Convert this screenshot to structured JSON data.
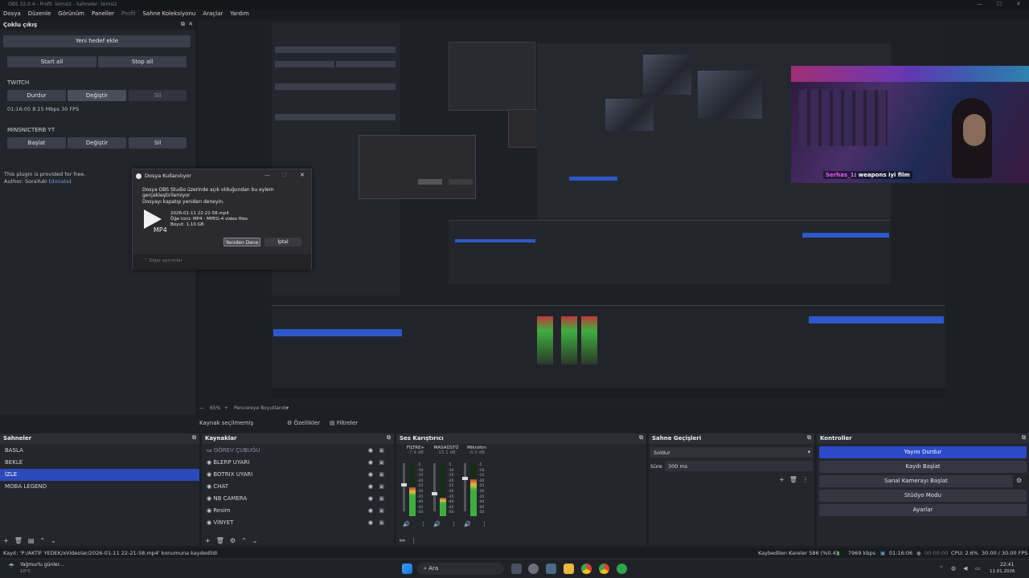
{
  "window": {
    "title": "OBS 32.0.4 - Profil: İsimsiz - Sahneler: İsimsiz"
  },
  "menu": [
    "Dosya",
    "Düzenle",
    "Görünüm",
    "Paneller",
    "Profil",
    "Sahne Koleksiyonu",
    "Araçlar",
    "Yardım"
  ],
  "multi_output": {
    "title": "Çoklu çıkış",
    "new_target": "Yeni hedef ekle",
    "start_all": "Start all",
    "stop_all": "Stop all",
    "targets": [
      {
        "name": "TWITCH",
        "primary": "Durdur",
        "edit": "Değiştir",
        "delete": "Sil",
        "stats": "01:16:05  8.15 Mbps  30 FPS"
      },
      {
        "name": "MINSNICTERB YT",
        "primary": "Başlat",
        "edit": "Değiştir",
        "delete": "Sil"
      }
    ],
    "plugin_note": "This plugin is provided for free.",
    "author_prefix": "Author: SoraYuki (",
    "author_link": "donate",
    "author_suffix": ")"
  },
  "dialog": {
    "title": "Dosya Kullanılıyor",
    "message": "Dosya OBS Studio üzerinde açık olduğundan bu eylem gerçekleştirilemiyor",
    "retry_hint": "Dosyayı kapatıp yeniden deneyin.",
    "file_name": "2026-01-11 22-21-58.mp4",
    "file_type": "Öğe türü: MP4 - MPEG-4 video files",
    "file_size": "Boyut: 1,10 GB",
    "badge": "MP4",
    "retry": "Yeniden Dene",
    "cancel": "İptal",
    "more": "Diğer ayrıntılar"
  },
  "preview": {
    "zoom": "65%",
    "fit": "Pencereye Boyutlandır"
  },
  "chat": {
    "user": "Serhas_1",
    "message": ": weapons iyi film"
  },
  "source_bar": {
    "selected": "Kaynak seçilmemiş",
    "properties": "Özellikler",
    "filters": "Filtreler"
  },
  "scenes": {
    "title": "Sahneler",
    "items": [
      "BASLA",
      "BEKLE",
      "İZLE",
      "MOBA LEGEND"
    ],
    "selected": 2
  },
  "sources": {
    "title": "Kaynaklar",
    "items": [
      "GÖREV ÇUBUĞU",
      "BLERP UYARI",
      "BOTRIX UYARI",
      "CHAT",
      "NB CAMERA",
      "Resim",
      "VİNYET"
    ]
  },
  "mixer": {
    "title": "Ses Karıştırıcı",
    "channels": [
      {
        "name": "FİLTRE+",
        "db": "-7.9 dB",
        "level": 0.55
      },
      {
        "name": "MASAÜSTÜ",
        "db": "-15.1 dB",
        "level": 0.35
      },
      {
        "name": "Mikrofon",
        "db": "-0.0 dB",
        "level": 0.7
      }
    ],
    "scale": [
      "-5",
      "-10",
      "-15",
      "-20",
      "-25",
      "-30",
      "-35",
      "-40",
      "-45",
      "-50"
    ]
  },
  "transitions": {
    "title": "Sahne Geçişleri",
    "type": "Soldur",
    "duration_label": "Süre",
    "duration": "300 ms"
  },
  "controls": {
    "title": "Kontroller",
    "items": [
      "Yayını Durdur",
      "Kaydı Başlat",
      "Sanal Kamerayı Başlat",
      "Stüdyo Modu",
      "Ayarlar"
    ]
  },
  "status": {
    "saved": "Kayıt: 'P:/AKTİF YEDEK/xVideolar/2026-01-11 22-21-58.mp4' konumuna kaydedildi",
    "dropped": "Kaybedilen Kareler 586 (%0.4)",
    "kbps": "7969 kbps",
    "stream_time": "01:16:06",
    "rec_time": "00:00:00",
    "cpu": "CPU: 2.6%",
    "fps": "30.00 / 30.00 FPS"
  },
  "taskbar": {
    "weather": "Yağmurlu günler...",
    "temp": "10°C",
    "search": "Ara",
    "time": "22:41",
    "date": "11.01.2026"
  },
  "colors": {
    "accent": "#2b49c8",
    "selected": "#2b49b8",
    "meter_green": "#3fae3f",
    "meter_red": "#c03a3a"
  }
}
